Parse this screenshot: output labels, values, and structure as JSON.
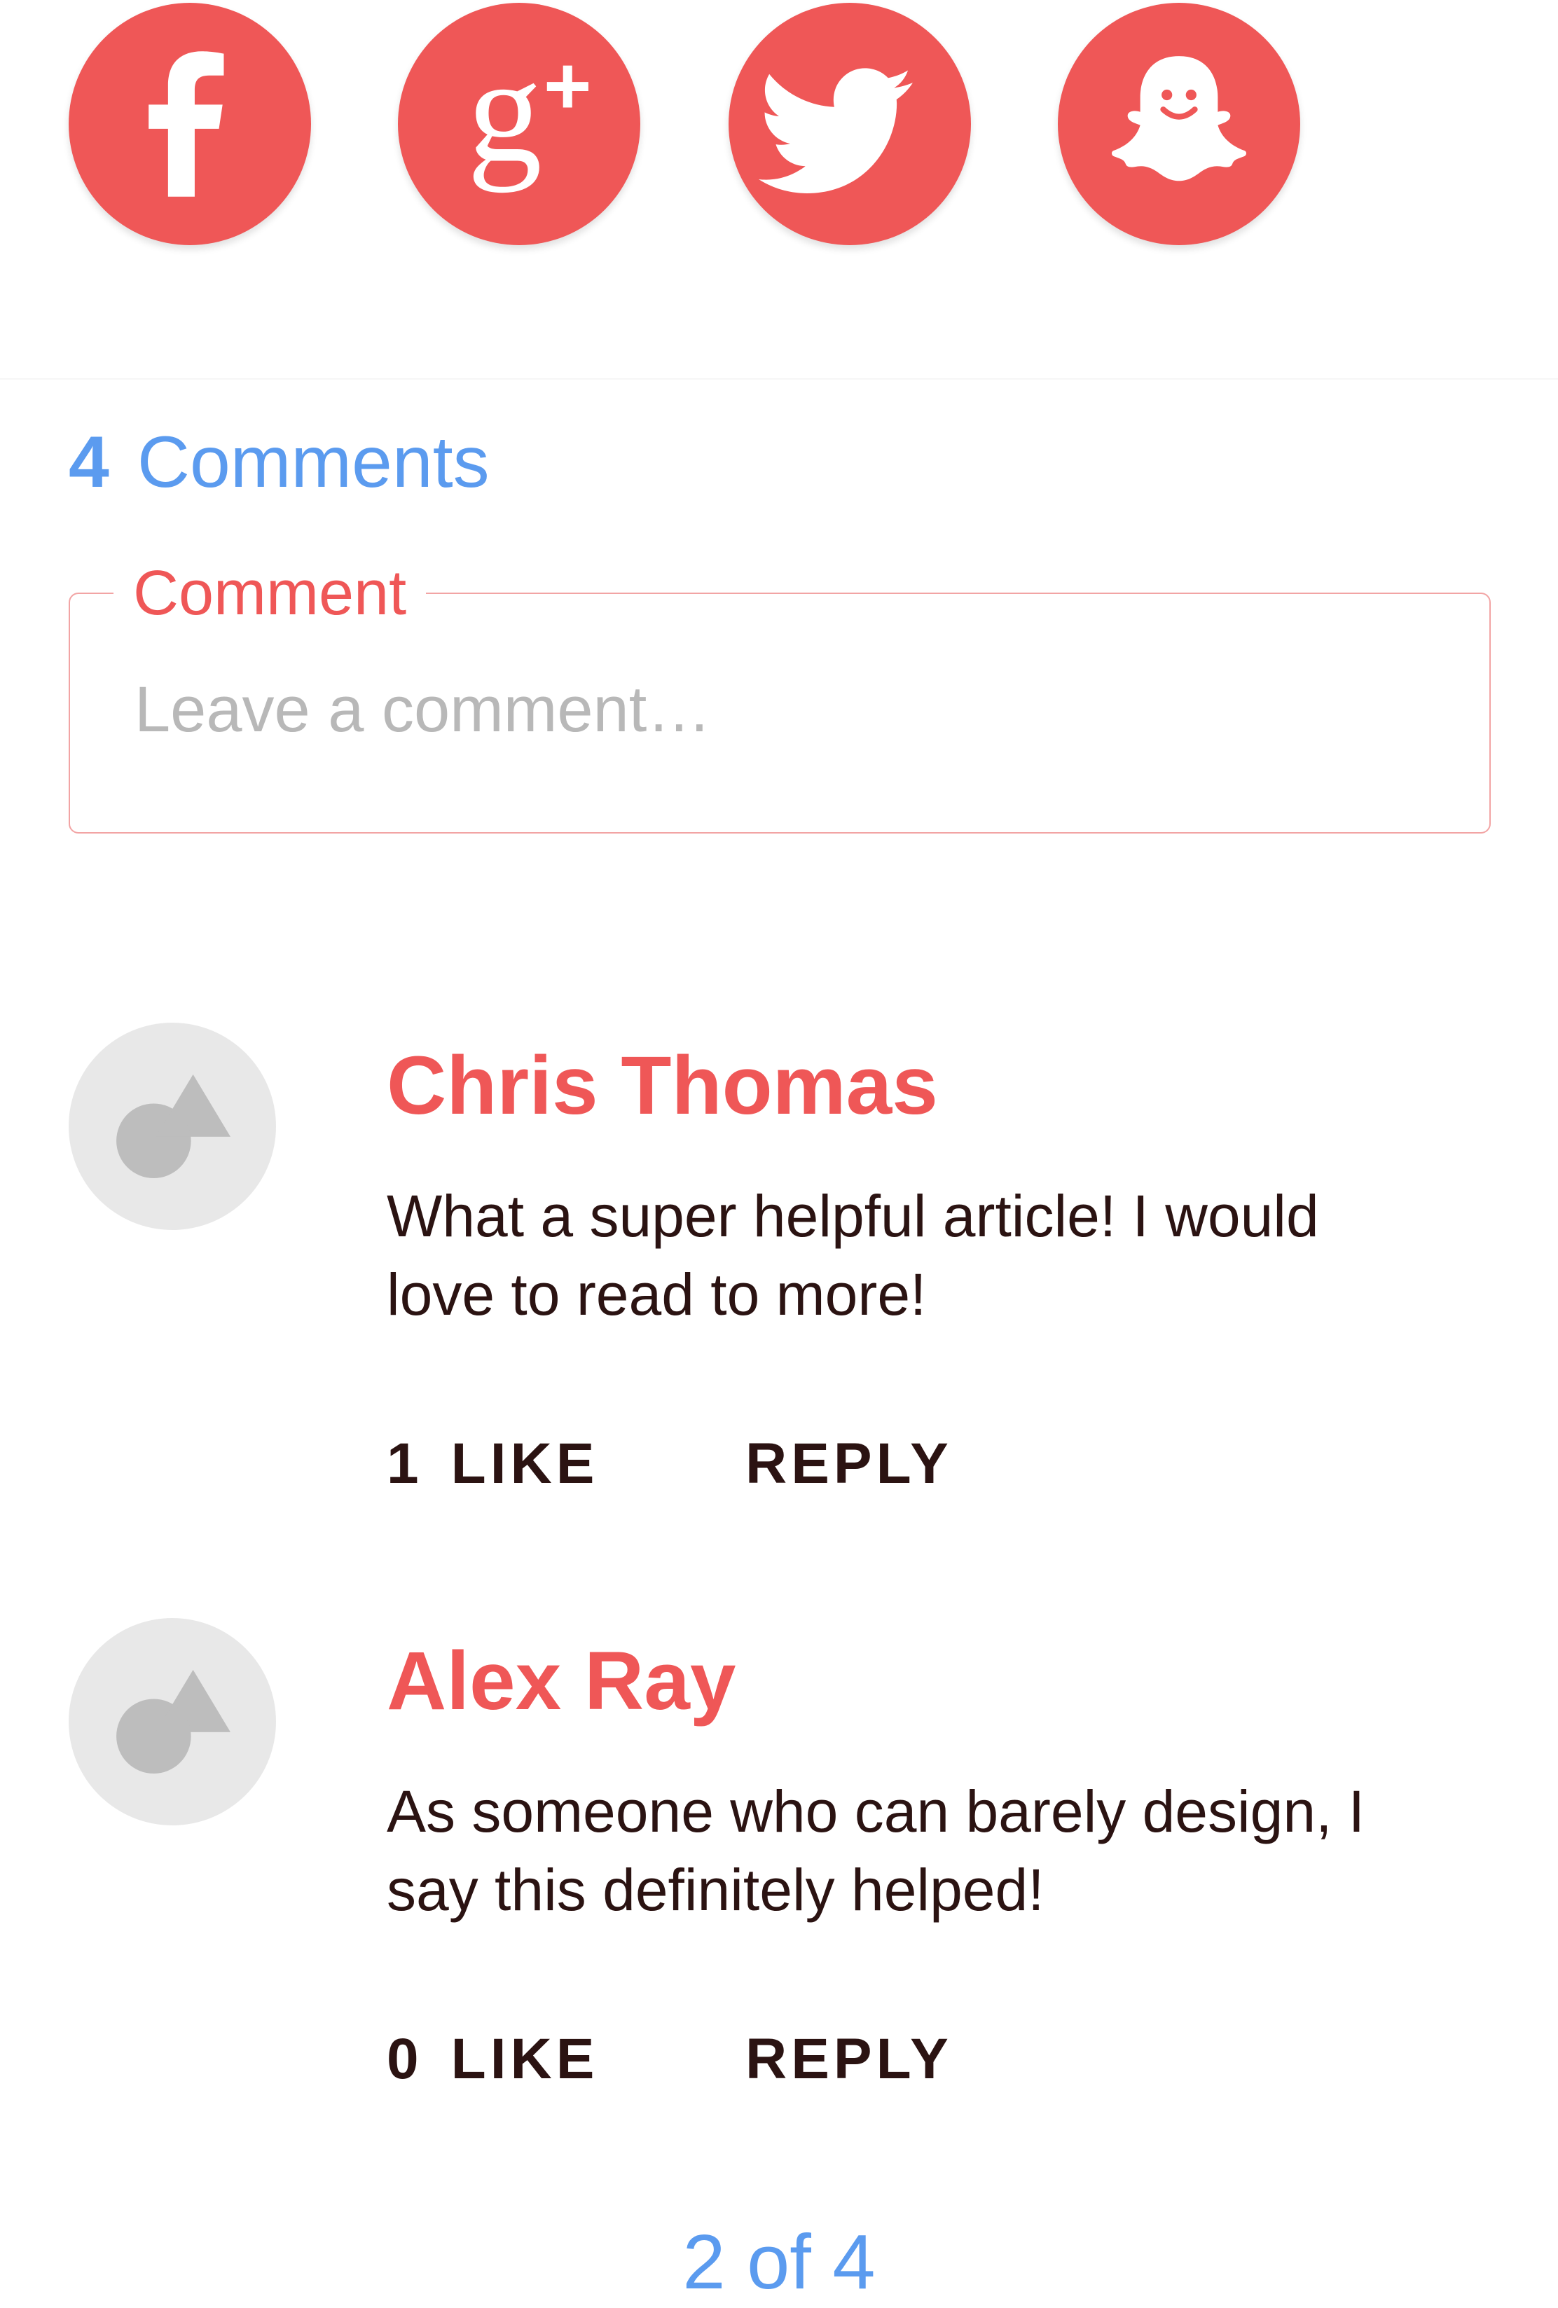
{
  "colors": {
    "accent": "#EF5757",
    "link": "#5B9BEF",
    "text": "#2B1312",
    "avatar_bg": "#E8E8E8",
    "placeholder": "#B8B8B8"
  },
  "share": {
    "buttons": [
      {
        "icon": "facebook-icon"
      },
      {
        "icon": "google-plus-icon"
      },
      {
        "icon": "twitter-icon"
      },
      {
        "icon": "snapchat-icon"
      }
    ]
  },
  "comments_header": {
    "count": "4",
    "label": "Comments"
  },
  "comment_input": {
    "label": "Comment",
    "placeholder": "Leave a comment…",
    "value": ""
  },
  "comments": [
    {
      "author": "Chris Thomas",
      "text": "What a super helpful article! I would love to read to more!",
      "likes": "1",
      "like_label": "LIKE",
      "reply_label": "REPLY",
      "avatar_icon": "avatar-placeholder-icon"
    },
    {
      "author": "Alex Ray",
      "text": "As someone who can barely design, I say this definitely helped!",
      "likes": "0",
      "like_label": "LIKE",
      "reply_label": "REPLY",
      "avatar_icon": "avatar-placeholder-icon"
    }
  ],
  "pagination": {
    "text": "2 of 4"
  }
}
